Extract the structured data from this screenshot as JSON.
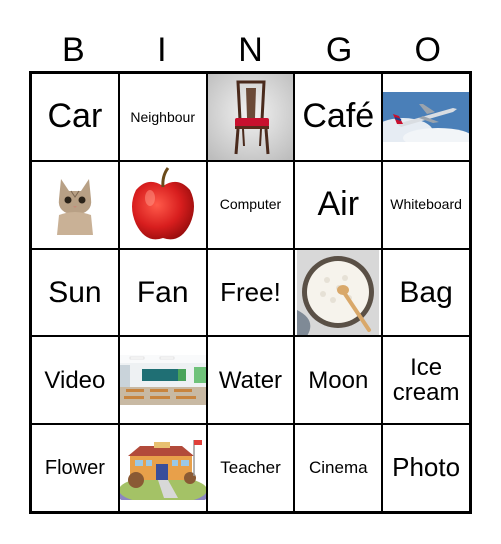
{
  "header": [
    "B",
    "I",
    "N",
    "G",
    "O"
  ],
  "cells": [
    {
      "type": "text",
      "text": "Car",
      "size": "xl"
    },
    {
      "type": "text",
      "text": "Neighbour",
      "size": "xxs"
    },
    {
      "type": "image",
      "icon": "chair-icon"
    },
    {
      "type": "text",
      "text": "Café",
      "size": "xl"
    },
    {
      "type": "image",
      "icon": "airplane-icon"
    },
    {
      "type": "image",
      "icon": "cat-icon"
    },
    {
      "type": "image",
      "icon": "apple-icon"
    },
    {
      "type": "text",
      "text": "Computer",
      "size": "xxs"
    },
    {
      "type": "text",
      "text": "Air",
      "size": "xl"
    },
    {
      "type": "text",
      "text": "Whiteboard",
      "size": "xxs"
    },
    {
      "type": "text",
      "text": "Sun",
      "size": "l"
    },
    {
      "type": "text",
      "text": "Fan",
      "size": "l"
    },
    {
      "type": "text",
      "text": "Free!",
      "size": "m",
      "free": true
    },
    {
      "type": "image",
      "icon": "rice-bowl-icon"
    },
    {
      "type": "text",
      "text": "Bag",
      "size": "l"
    },
    {
      "type": "text",
      "text": "Video",
      "size": "ml"
    },
    {
      "type": "image",
      "icon": "classroom-icon"
    },
    {
      "type": "text",
      "text": "Water",
      "size": "ml"
    },
    {
      "type": "text",
      "text": "Moon",
      "size": "ml"
    },
    {
      "type": "text",
      "text": "Ice cream",
      "size": "ml"
    },
    {
      "type": "text",
      "text": "Flower",
      "size": "s"
    },
    {
      "type": "image",
      "icon": "school-icon"
    },
    {
      "type": "text",
      "text": "Teacher",
      "size": "xs"
    },
    {
      "type": "text",
      "text": "Cinema",
      "size": "xs"
    },
    {
      "type": "text",
      "text": "Photo",
      "size": "m"
    }
  ]
}
